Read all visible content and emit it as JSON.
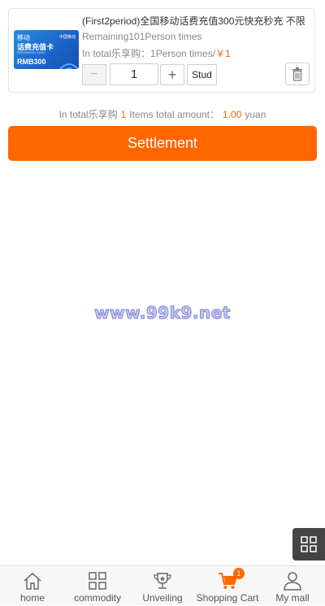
{
  "cart_item": {
    "thumbnail": {
      "line1": "移动",
      "line2": "话费充值卡",
      "line3": "RECHARGE CARD",
      "brand": "中国移动",
      "amount": "RMB300"
    },
    "title": "(First2period)全国移动话费充值300元快充秒充 不限",
    "remaining": "Remaining101Person times",
    "total_prefix": "In total乐享购：1Person times/",
    "price": "￥1",
    "qty_minus": "−",
    "quantity": "1",
    "qty_plus": "+",
    "stud_label": "Stud"
  },
  "summary": {
    "prefix": "In total乐享购",
    "count": "1",
    "mid": "Items total amount：",
    "amount": "1.00",
    "suffix": "yuan"
  },
  "settle_label": "Settlement",
  "watermark": "www.99k9.net",
  "tabs": [
    {
      "label": "home",
      "icon": "home-icon"
    },
    {
      "label": "commodity",
      "icon": "grid-icon"
    },
    {
      "label": "Unveiling",
      "icon": "trophy-icon"
    },
    {
      "label": "Shopping Cart",
      "icon": "cart-icon",
      "badge": "1"
    },
    {
      "label": "My mall",
      "icon": "user-icon"
    }
  ],
  "colors": {
    "accent": "#ff6600",
    "tab_bg": "#f7f7f7"
  }
}
